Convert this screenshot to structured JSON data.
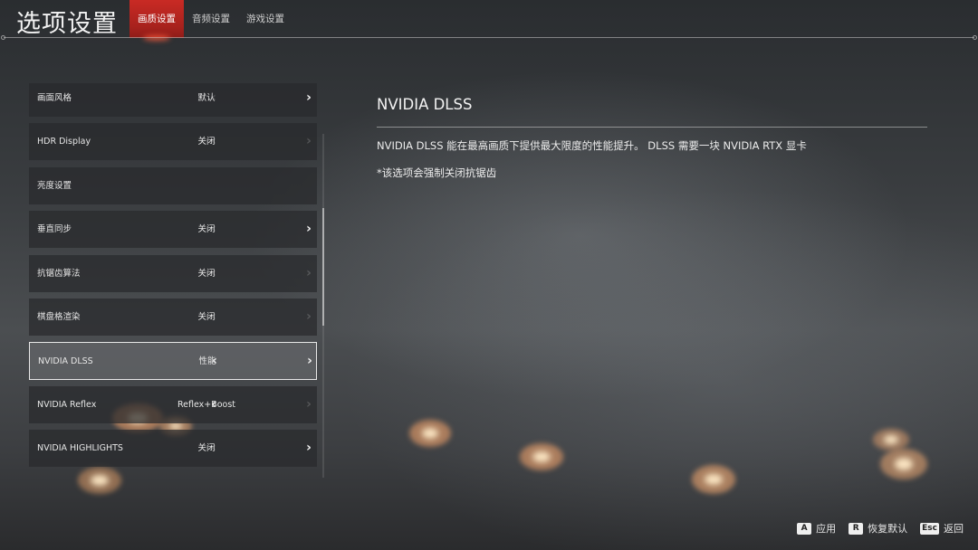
{
  "header": {
    "title": "选项设置",
    "tabs": [
      {
        "label": "画质设置",
        "active": true
      },
      {
        "label": "音频设置",
        "active": false
      },
      {
        "label": "游戏设置",
        "active": false
      }
    ]
  },
  "settings": {
    "rows": [
      {
        "label": "画面风格",
        "value": "默认",
        "left_enabled": false,
        "right_enabled": true
      },
      {
        "label": "HDR Display",
        "value": "关闭",
        "left_enabled": false,
        "right_enabled": false
      },
      {
        "label": "亮度设置",
        "value": "",
        "left_enabled": false,
        "right_enabled": false
      },
      {
        "label": "垂直同步",
        "value": "关闭",
        "left_enabled": false,
        "right_enabled": true
      },
      {
        "label": "抗锯齿算法",
        "value": "关闭",
        "left_enabled": false,
        "right_enabled": false
      },
      {
        "label": "棋盘格渲染",
        "value": "关闭",
        "left_enabled": false,
        "right_enabled": false
      },
      {
        "label": "NVIDIA DLSS",
        "value": "性能",
        "left_enabled": true,
        "right_enabled": true,
        "selected": true
      },
      {
        "label": "NVIDIA Reflex",
        "value": "Reflex+Boost",
        "left_enabled": true,
        "right_enabled": false
      },
      {
        "label": "NVIDIA HIGHLIGHTS",
        "value": "关闭",
        "left_enabled": false,
        "right_enabled": true
      }
    ],
    "left_arrow_icon": "chevron-left-icon",
    "right_arrow_icon": "chevron-right-icon"
  },
  "detail": {
    "title": "NVIDIA DLSS",
    "description": "NVIDIA DLSS 能在最高画质下提供最大限度的性能提升。 DLSS 需要一块 NVIDIA RTX 显卡",
    "note": "*该选项会强制关闭抗锯齿"
  },
  "footer": {
    "hints": [
      {
        "key": "A",
        "label": "应用"
      },
      {
        "key": "R",
        "label": "恢复默认"
      },
      {
        "key": "Esc",
        "label": "返回"
      }
    ]
  },
  "colors": {
    "accent": "#c92a24",
    "text": "#e8e8e8"
  }
}
